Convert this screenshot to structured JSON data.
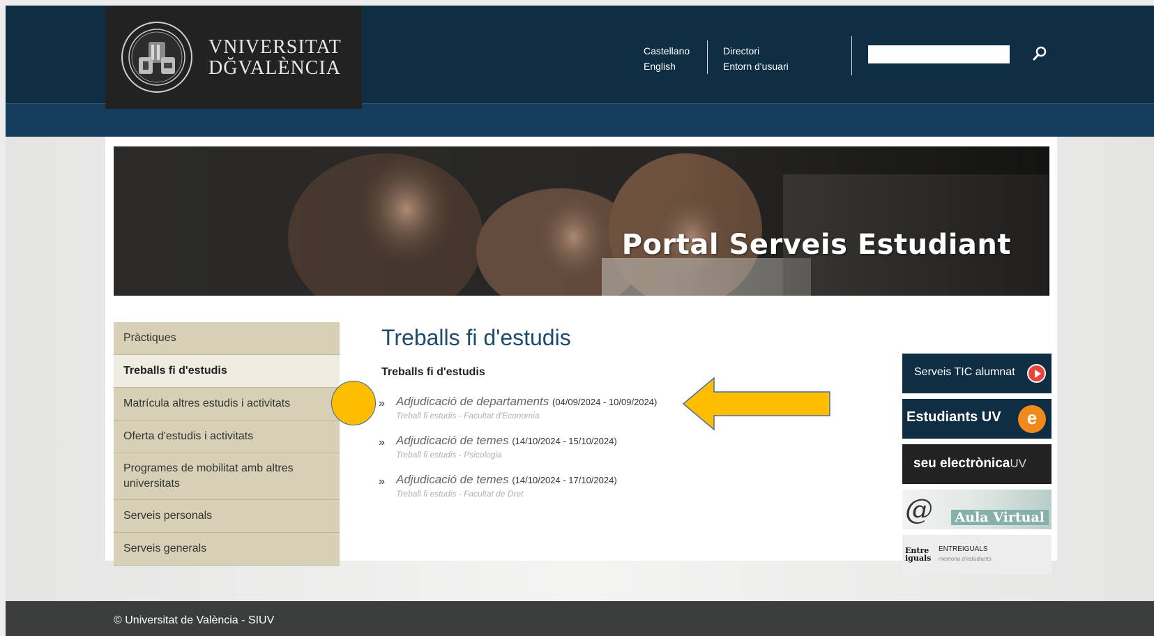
{
  "header": {
    "logo": {
      "line1": "VNIVERSITAT",
      "line2": "DĞVALÈNCIA"
    },
    "lang_links": [
      "Castellano",
      "English"
    ],
    "util_links": [
      "Directori",
      "Entorn d'usuari"
    ],
    "search": {
      "placeholder": ""
    }
  },
  "banner": {
    "title": "Portal Serveis Estudiant"
  },
  "sidebar": {
    "items": [
      {
        "label": "Pràctiques",
        "active": false
      },
      {
        "label": "Treballs fi d'estudis",
        "active": true
      },
      {
        "label": "Matrícula altres estudis i activitats",
        "active": false
      },
      {
        "label": "Oferta d'estudis i activitats",
        "active": false
      },
      {
        "label": "Programes de mobilitat amb altres universitats",
        "active": false
      },
      {
        "label": "Serveis personals",
        "active": false
      },
      {
        "label": "Serveis generals",
        "active": false
      }
    ]
  },
  "main": {
    "title": "Treballs fi d'estudis",
    "subtitle": "Treballs fi d'estudis",
    "tasks": [
      {
        "title": "Adjudicació de departaments",
        "dates": "(04/09/2024 - 10/09/2024)",
        "origin": "Treball fi estudis - Facultat d'Economia"
      },
      {
        "title": "Adjudicació de temes",
        "dates": "(14/10/2024 - 15/10/2024)",
        "origin": "Treball fi estudis - Psicologia"
      },
      {
        "title": "Adjudicació de temes",
        "dates": "(14/10/2024 - 17/10/2024)",
        "origin": "Treball fi estudis - Facultat de Dret"
      }
    ]
  },
  "right_col": {
    "tic": "Serveis TIC alumnat",
    "estudiants": "Estudiants UV",
    "estudiants_badge": "e",
    "seu_main": "seu electrònica",
    "seu_suffix": "UV",
    "aula": "Aula Virtual",
    "aula_symbol": "@",
    "entre_line1": "Entre",
    "entre_line2": "iguals",
    "entre_brand": "ENTREIGUALS",
    "entre_tagline": "mentoria d'estudiants"
  },
  "footer": {
    "text": "© Universitat de València - SIUV"
  },
  "colors": {
    "header_bg": "#0f2d43",
    "subbar_bg": "#163e5c",
    "sidebar_bg": "#d8d0b6",
    "sidebar_active_bg": "#efece1",
    "title_color": "#1f4b6b",
    "annotation": "#ffbd00"
  },
  "icons": {
    "search": "search-icon",
    "play": "play-circle-icon"
  }
}
